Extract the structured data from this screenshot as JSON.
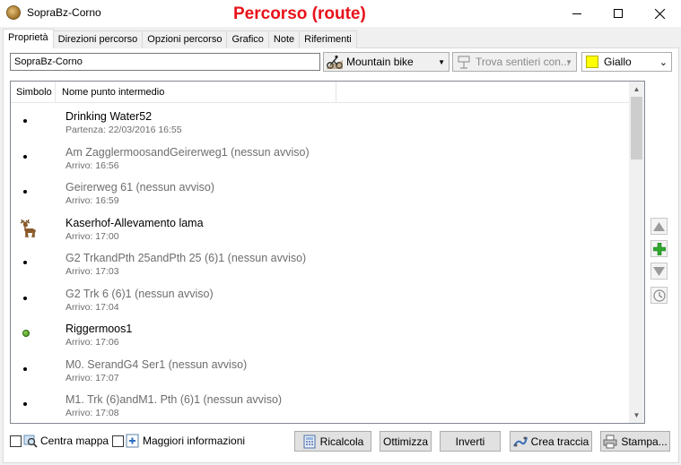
{
  "window": {
    "title": "SopraBz-Corno",
    "overlay_title": "Percorso (route)"
  },
  "tabs": [
    {
      "label": "Proprietà",
      "active": true
    },
    {
      "label": "Direzioni percorso",
      "active": false
    },
    {
      "label": "Opzioni percorso",
      "active": false
    },
    {
      "label": "Grafico",
      "active": false
    },
    {
      "label": "Note",
      "active": false
    },
    {
      "label": "Riferimenti",
      "active": false
    }
  ],
  "route": {
    "name_value": "SopraBz-Corno",
    "activity": "Mountain bike",
    "find_trails": "Trova sentieri con...",
    "color": "Giallo",
    "color_hex": "#ffff00"
  },
  "list": {
    "col_symbol": "Simbolo",
    "col_name": "Nome punto intermedio",
    "rows": [
      {
        "symbol": "dot",
        "name": "Drinking Water52",
        "sub": "Partenza: 22/03/2016 16:55",
        "muted": false
      },
      {
        "symbol": "dot",
        "name": "Am ZagglermoosandGeirerweg1 (nessun avviso)",
        "sub": "Arrivo: 16:56",
        "muted": true
      },
      {
        "symbol": "dot",
        "name": "Geirerweg 61 (nessun avviso)",
        "sub": "Arrivo: 16:59",
        "muted": true
      },
      {
        "symbol": "deer-icon",
        "name": "Kaserhof-Allevamento lama",
        "sub": "Arrivo: 17:00",
        "muted": false
      },
      {
        "symbol": "dot",
        "name": "G2 TrkandPth 25andPth 25 (6)1 (nessun avviso)",
        "sub": "Arrivo: 17:03",
        "muted": true
      },
      {
        "symbol": "dot",
        "name": "G2 Trk 6 (6)1 (nessun avviso)",
        "sub": "Arrivo: 17:04",
        "muted": true
      },
      {
        "symbol": "green-dot",
        "name": "Riggermoos1",
        "sub": "Arrivo: 17:06",
        "muted": false
      },
      {
        "symbol": "dot",
        "name": "M0. SerandG4 Ser1 (nessun avviso)",
        "sub": "Arrivo: 17:07",
        "muted": true
      },
      {
        "symbol": "dot",
        "name": "M1. Trk (6)andM1. Pth (6)1 (nessun avviso)",
        "sub": "Arrivo: 17:08",
        "muted": true
      }
    ]
  },
  "bottom": {
    "center_map": "Centra mappa",
    "more_info": "Maggiori informazioni",
    "recalc": "Ricalcola",
    "optimize": "Ottimizza",
    "reverse": "Inverti",
    "create_track": "Crea traccia",
    "print": "Stampa..."
  }
}
